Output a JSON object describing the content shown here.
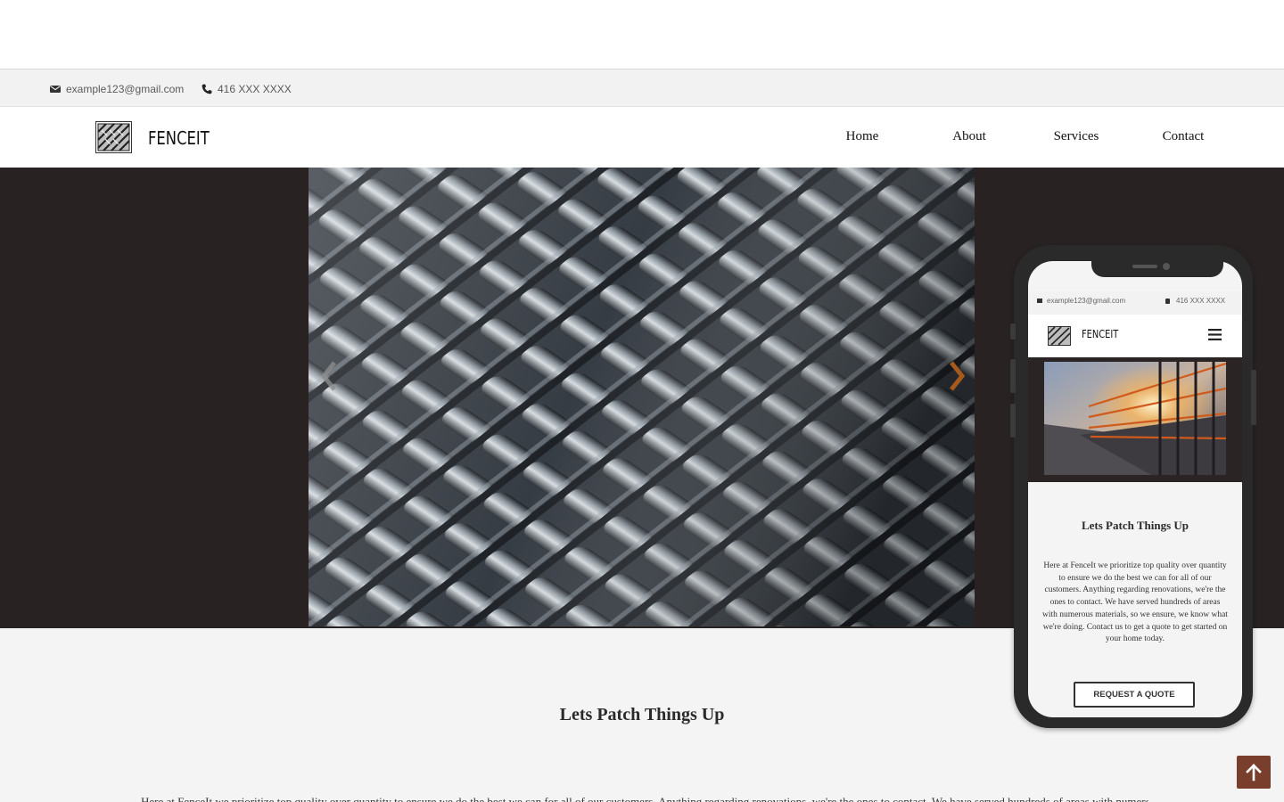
{
  "contact_bar": {
    "email": "example123@gmail.com",
    "phone": "416 XXX XXXX",
    "email_icon": "envelope-icon",
    "phone_icon": "phone-icon"
  },
  "nav": {
    "brand": "FENCEIT",
    "logo_icon": "fence-logo-icon",
    "links": [
      "Home",
      "About",
      "Services",
      "Contact"
    ]
  },
  "hero": {
    "prev_icon": "chevron-left-icon",
    "next_icon": "chevron-right-icon",
    "accent": "#a55a1c"
  },
  "mission": {
    "title": "Lets Patch Things Up",
    "text": "Here at FenceIt we prioritize top quality over quantity to ensure we do the best we can for all of our customers. Anything regarding renovations, we're the ones to contact. We have served hundreds of areas with numerous"
  },
  "phone_mockup": {
    "email": "example123@gmail.com",
    "phone": "416 XXX XXXX",
    "brand": "FENCEIT",
    "menu_icon": "hamburger-icon",
    "title": "Lets Patch Things Up",
    "text": "Here at FenceIt we prioritize top quality over quantity to ensure we do the best we can for all of our customers. Anything regarding renovations, we're the ones to contact. We have served hundreds of areas with numerous materials, so we ensure, we know what we're doing. Contact us to get a quote to get started on your home today.",
    "button": "REQUEST A QUOTE"
  },
  "scroll_top": {
    "icon": "arrow-up-icon",
    "color": "#7a3f2c"
  }
}
